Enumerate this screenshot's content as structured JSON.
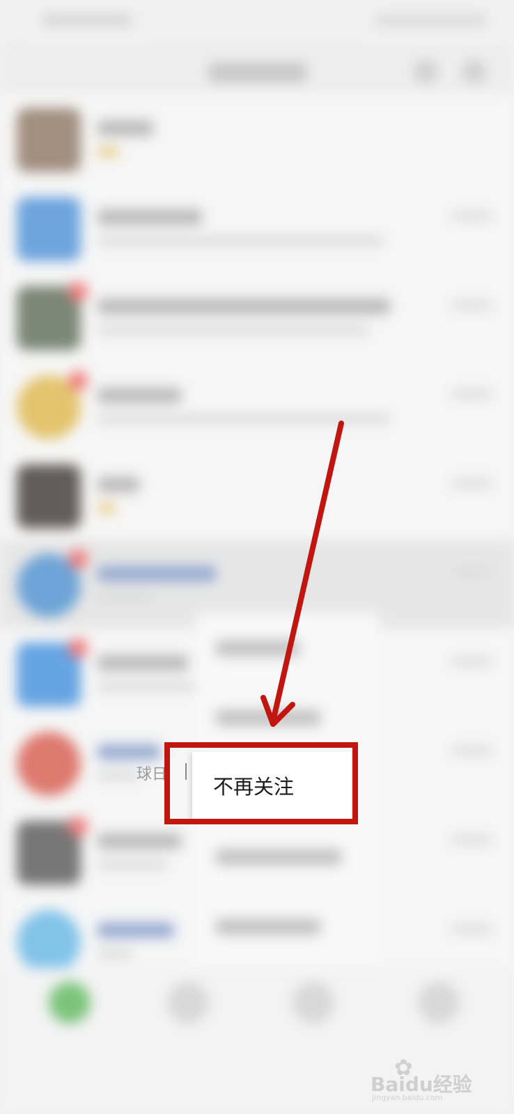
{
  "context_menu": {
    "partial_item_text": "球日",
    "unfollow_label": "不再关注"
  },
  "watermark": {
    "brand": "Baidu经验",
    "url": "jingyan.baidu.com",
    "icon": "paw-icon"
  },
  "annotation": {
    "box_color": "#c1160f",
    "arrow_color": "#c1160f"
  }
}
